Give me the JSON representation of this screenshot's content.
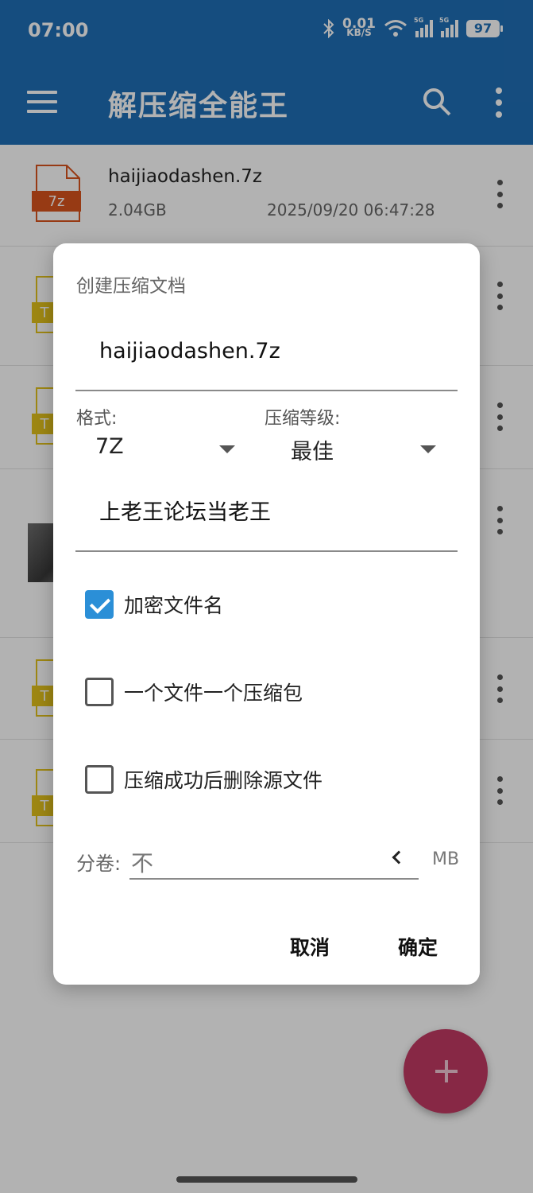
{
  "status_bar": {
    "time": "07:00",
    "net_speed_value": "0.01",
    "net_speed_unit": "KB/S",
    "signal_label_1": "5G",
    "signal_label_2": "5G",
    "battery": "97"
  },
  "app_bar": {
    "title": "解压缩全能王",
    "menu_icon": "hamburger-menu-icon",
    "search_icon": "search-icon",
    "more_icon": "more-vert-icon"
  },
  "file_list": {
    "items": [
      {
        "name": "haijiaodashen.7z",
        "size": "2.04GB",
        "date": "2025/09/20 06:47:28",
        "type_badge": "7z"
      },
      {
        "type_badge": "T"
      },
      {
        "type_badge": "T"
      },
      {
        "type_badge": "image"
      },
      {
        "type_badge": "T"
      },
      {
        "type_badge": "T"
      }
    ]
  },
  "dialog": {
    "title": "创建压缩文档",
    "filename_value": "haijiaodashen.7z",
    "format_label": "格式:",
    "format_value": "7Z",
    "level_label": "压缩等级:",
    "level_value": "最佳",
    "password_value": "上老王论坛当老王",
    "checkboxes": [
      {
        "label": "加密文件名",
        "checked": true
      },
      {
        "label": "一个文件一个压缩包",
        "checked": false
      },
      {
        "label": "压缩成功后删除源文件",
        "checked": false
      }
    ],
    "split_label": "分卷:",
    "split_value": "不",
    "split_unit": "MB",
    "cancel_label": "取消",
    "ok_label": "确定"
  },
  "colors": {
    "app_bar": "#1f6fb6",
    "fab": "#c23a63",
    "checkbox_on": "#2b8fd7",
    "badge_7z": "#d9531e",
    "badge_t": "#e2c21c"
  }
}
